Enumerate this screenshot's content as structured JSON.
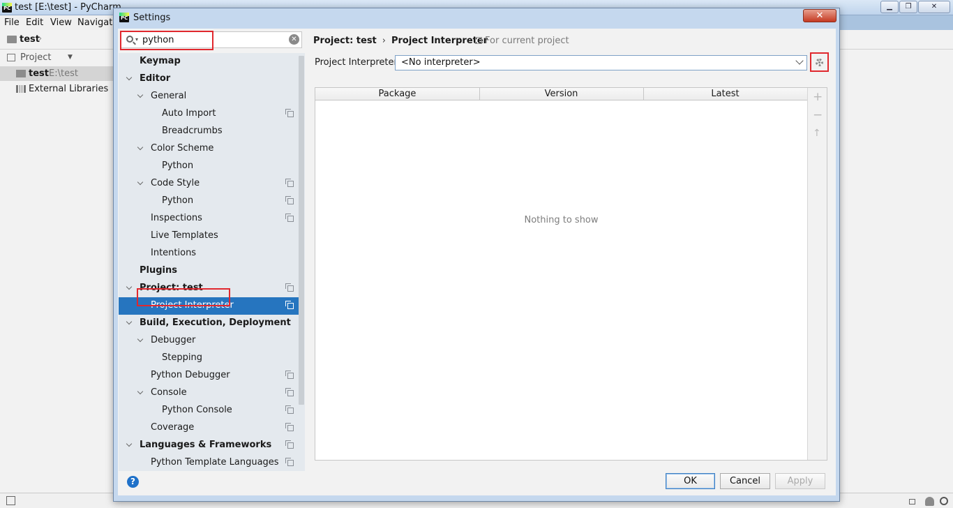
{
  "main_window": {
    "title": "test [E:\\test] - PyCharm",
    "menu": [
      "File",
      "Edit",
      "View",
      "Navigate"
    ],
    "nav_project": "test",
    "project_panel_label": "Project",
    "tree": [
      {
        "name": "test",
        "path": "E:\\test"
      },
      {
        "name": "External Libraries",
        "path": ""
      }
    ]
  },
  "dialog": {
    "title": "Settings",
    "close_label": "✕",
    "search": {
      "value": "python",
      "placeholder": ""
    },
    "tree": [
      {
        "label": "Keymap",
        "bold": true,
        "level": 0,
        "expand": false,
        "copy": false
      },
      {
        "label": "Editor",
        "bold": true,
        "level": 0,
        "expand": true,
        "copy": false
      },
      {
        "label": "General",
        "bold": false,
        "level": 1,
        "expand": true,
        "copy": false
      },
      {
        "label": "Auto Import",
        "bold": false,
        "level": 2,
        "expand": false,
        "copy": true
      },
      {
        "label": "Breadcrumbs",
        "bold": false,
        "level": 2,
        "expand": false,
        "copy": false
      },
      {
        "label": "Color Scheme",
        "bold": false,
        "level": 1,
        "expand": true,
        "copy": false
      },
      {
        "label": "Python",
        "bold": false,
        "level": 2,
        "expand": false,
        "copy": false
      },
      {
        "label": "Code Style",
        "bold": false,
        "level": 1,
        "expand": true,
        "copy": true
      },
      {
        "label": "Python",
        "bold": false,
        "level": 2,
        "expand": false,
        "copy": true
      },
      {
        "label": "Inspections",
        "bold": false,
        "level": 1,
        "expand": false,
        "copy": true
      },
      {
        "label": "Live Templates",
        "bold": false,
        "level": 1,
        "expand": false,
        "copy": false
      },
      {
        "label": "Intentions",
        "bold": false,
        "level": 1,
        "expand": false,
        "copy": false
      },
      {
        "label": "Plugins",
        "bold": true,
        "level": 0,
        "expand": false,
        "copy": false
      },
      {
        "label": "Project: test",
        "bold": true,
        "level": 0,
        "expand": true,
        "copy": true
      },
      {
        "label": "Project Interpreter",
        "bold": false,
        "level": 1,
        "expand": false,
        "copy": true,
        "selected": true
      },
      {
        "label": "Build, Execution, Deployment",
        "bold": true,
        "level": 0,
        "expand": true,
        "copy": false
      },
      {
        "label": "Debugger",
        "bold": false,
        "level": 1,
        "expand": true,
        "copy": false
      },
      {
        "label": "Stepping",
        "bold": false,
        "level": 2,
        "expand": false,
        "copy": false
      },
      {
        "label": "Python Debugger",
        "bold": false,
        "level": 1,
        "expand": false,
        "copy": true
      },
      {
        "label": "Console",
        "bold": false,
        "level": 1,
        "expand": true,
        "copy": true
      },
      {
        "label": "Python Console",
        "bold": false,
        "level": 2,
        "expand": false,
        "copy": true
      },
      {
        "label": "Coverage",
        "bold": false,
        "level": 1,
        "expand": false,
        "copy": true
      },
      {
        "label": "Languages & Frameworks",
        "bold": true,
        "level": 0,
        "expand": true,
        "copy": true
      },
      {
        "label": "Python Template Languages",
        "bold": false,
        "level": 1,
        "expand": false,
        "copy": true
      }
    ],
    "breadcrumb": [
      "Project: test",
      "Project Interpreter"
    ],
    "scope_note": "For current project",
    "interpreter_label": "Project Interpreter:",
    "interpreter_value": "<No interpreter>",
    "table": {
      "columns": [
        "Package",
        "Version",
        "Latest"
      ],
      "empty_text": "Nothing to show",
      "tools": [
        "+",
        "−",
        "↑"
      ]
    },
    "buttons": {
      "ok": "OK",
      "cancel": "Cancel",
      "apply": "Apply",
      "help": "?"
    }
  },
  "colors": {
    "selection": "#2675bf",
    "highlight": "#e0282e"
  }
}
